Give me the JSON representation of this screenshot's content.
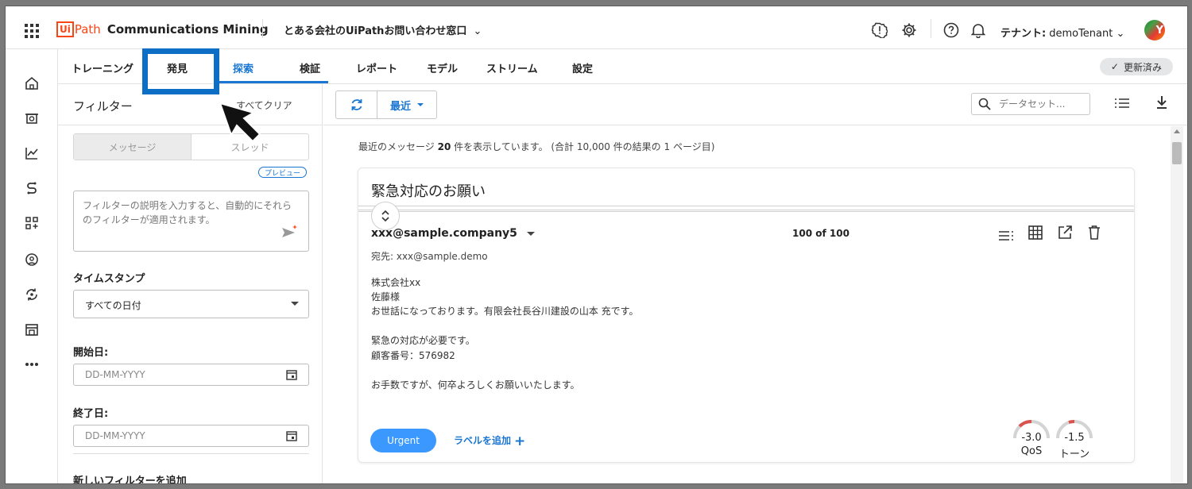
{
  "app": {
    "logo_ui": "Ui",
    "logo_path": "Path",
    "product": "Communications Mining",
    "project": "とある会社のUiPathお問い合わせ窓口",
    "tenant_label": "テナント:",
    "tenant_value": "demoTenant",
    "avatar_letter": "Y",
    "brand_color": "#fa4616"
  },
  "nav": {
    "tabs": [
      "トレーニング",
      "発見",
      "探索",
      "検証",
      "レポート",
      "モデル",
      "ストリーム",
      "設定"
    ],
    "active_tab": "探索",
    "status_badge": "更新済み"
  },
  "filter": {
    "title": "フィルター",
    "clear_all": "すべてクリア",
    "segments": [
      "メッセージ",
      "スレッド"
    ],
    "preview_badge": "プレビュー",
    "description_placeholder": "フィルターの説明を入力すると、自動的にそれらのフィルターが適用されます。",
    "timestamp_label": "タイムスタンプ",
    "timestamp_value": "すべての日付",
    "start_label": "開始日:",
    "start_placeholder": "DD-MM-YYYY",
    "end_label": "終了日:",
    "end_placeholder": "DD-MM-YYYY",
    "add_filter": "新しいフィルターを追加"
  },
  "toolbar": {
    "sort_label": "最近",
    "search_placeholder": "データセット..."
  },
  "results": {
    "prefix": "最近のメッセージ",
    "count": "20",
    "suffix": "件を表示しています。 (合計 10,000 件の結果の 1 ページ目)"
  },
  "message": {
    "subject": "緊急対応のお願い",
    "sender": "xxx@sample.company5",
    "position": "100 of 100",
    "to": "宛先: xxx@sample.demo",
    "body": [
      "株式会社xx",
      "佐藤様",
      "お世話になっております。有限会社長谷川建設の山本 充です。",
      "",
      "緊急の対応が必要です。",
      "顧客番号：576982",
      "",
      "お手数ですが、何卒よろしくお願いいたします。"
    ],
    "label": "Urgent",
    "add_label": "ラベルを追加",
    "label_color": "#3a98ff",
    "qos_value": "-3.0",
    "qos_label": "QoS",
    "tone_value": "-1.5",
    "tone_label": "トーン"
  },
  "accent_color": "#1976d2"
}
